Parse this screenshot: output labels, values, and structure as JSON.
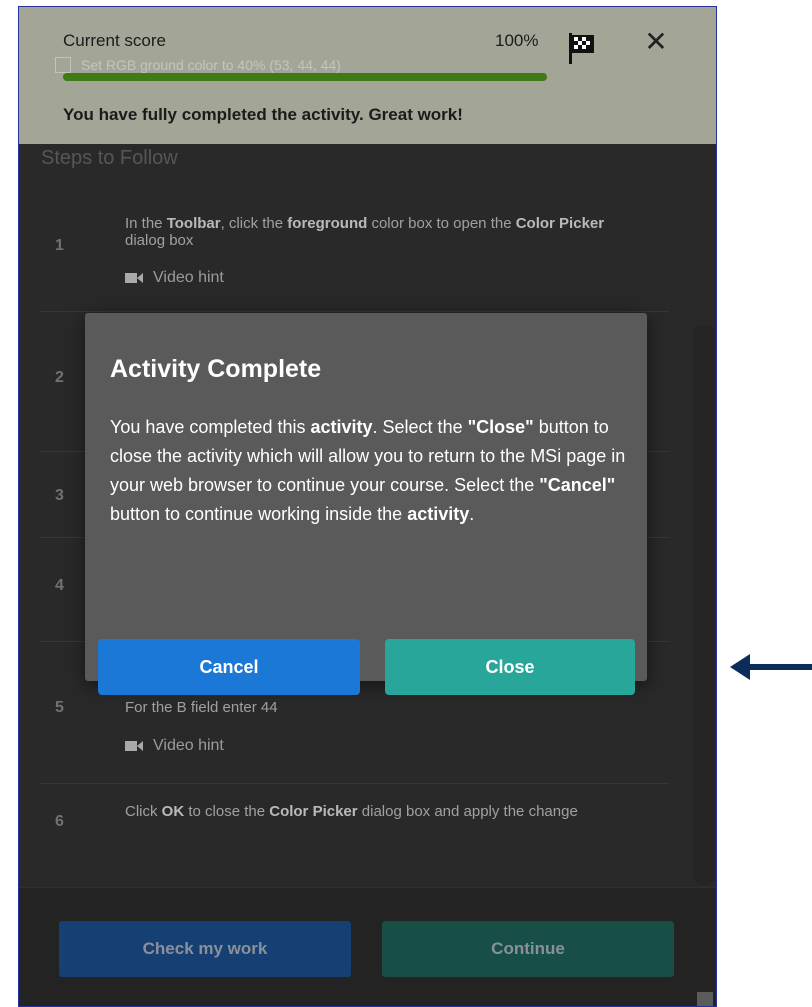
{
  "score": {
    "label": "Current score",
    "percent": "100%",
    "progress": 1.0,
    "hidden_step": "Set RGB ground color to 40% (53, 44, 44)",
    "message": "You have fully completed the activity. Great work!"
  },
  "steps": {
    "title": "Steps to Follow",
    "items": [
      {
        "num": "1",
        "p1": "In the ",
        "b1": "Toolbar",
        "p2": ", click the ",
        "b2": "foreground",
        "p3": " color box to open the ",
        "b3": "Color Picker",
        "p4": " dialog box",
        "hint": "Video hint"
      },
      {
        "num": "2"
      },
      {
        "num": "3"
      },
      {
        "num": "4"
      },
      {
        "num": "5",
        "text_partial": "For the B field enter 44",
        "hint": "Video hint"
      },
      {
        "num": "6",
        "p1": "Click ",
        "b1": "OK",
        "p2": " to close the ",
        "b2": "Color Picker",
        "p3": " dialog box and apply the change"
      }
    ]
  },
  "footer": {
    "check_label": "Check my work",
    "continue_label": "Continue"
  },
  "modal": {
    "title": "Activity Complete",
    "body": {
      "t1": "You have completed this ",
      "b1": "activity",
      "t2": ". Select the ",
      "b2": "\"Close\"",
      "t3": " button to close the activity which will allow you to return to the MSi  page in your web browser to continue your course. Select the ",
      "b3": "\"Cancel\"",
      "t4": " button to continue working inside the ",
      "b4": "activity",
      "t5": "."
    },
    "cancel_label": "Cancel",
    "close_label": "Close"
  },
  "colors": {
    "score_bg": "#a3a696",
    "panel_bg": "#333333",
    "modal_bg": "#5a5a5a",
    "cancel": "#1c78d6",
    "close": "#27a699",
    "arrow": "#0b2d5c"
  },
  "icons": [
    "flag-icon",
    "close-icon",
    "video-camera-icon",
    "arrow-left-icon"
  ]
}
